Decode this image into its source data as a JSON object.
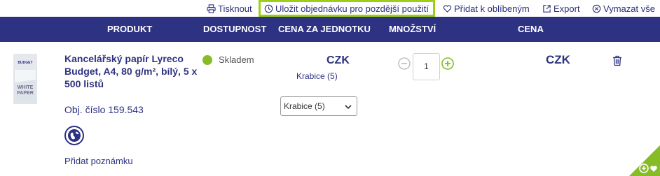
{
  "toolbar": {
    "print_label": "Tisknout",
    "save_order_label": "Uložit objednávku pro pozdější použití",
    "favorites_label": "Přidat k oblíbeným",
    "export_label": "Export",
    "clear_all_label": "Vymazat vše"
  },
  "table": {
    "headers": {
      "produkt": "PRODUKT",
      "dostupnost": "DOSTUPNOST",
      "cena_jednotku": "CENA ZA JEDNOTKU",
      "mnozstvi": "MNOŽSTVÍ",
      "cena": "CENA"
    }
  },
  "product": {
    "title": "Kancelářský papír Lyreco Budget, A4, 80 g/m², bílý, 5 x 500 listů",
    "obj_cislo": "Obj. číslo 159.543",
    "add_note": "Přidat poznámku",
    "stock": "Skladem",
    "unit_price": "CZK",
    "unit_text": "Krabice (5)",
    "unit_select": "Krabice  (5)",
    "quantity": "1",
    "total_price": "CZK",
    "image_text": {
      "brand": "BUDGET",
      "line1": "WHITE",
      "line2": "PAPER"
    }
  },
  "colors": {
    "navy": "#2d3282",
    "accent_green": "#9bd017",
    "stock_green": "#86bc25"
  },
  "icons": {
    "print": "printer-icon",
    "save": "clock-icon",
    "favorites": "heart-icon",
    "export": "external-link-icon",
    "clear": "close-circle-icon",
    "remove": "trash-icon"
  }
}
